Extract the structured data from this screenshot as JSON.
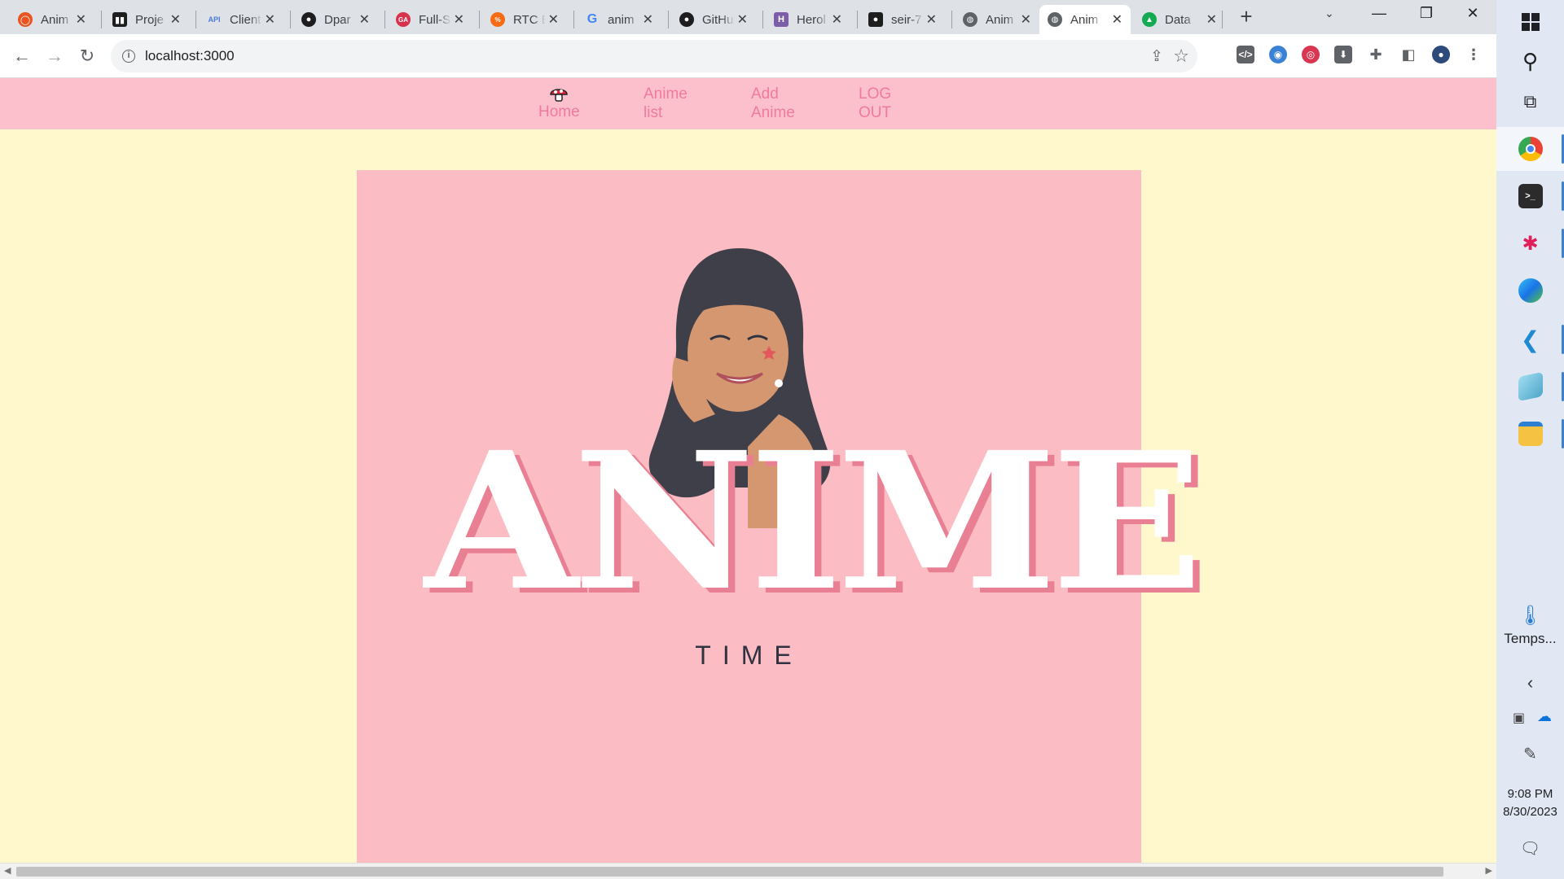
{
  "browser": {
    "tabs": [
      {
        "title": "Anim",
        "icon": "ubuntu-icon",
        "color": "#e95420"
      },
      {
        "title": "Proje",
        "icon": "trello-icon",
        "color": "#1e1e1e"
      },
      {
        "title": "Client",
        "icon": "api-icon",
        "color": "#4a7bd8"
      },
      {
        "title": "Dpar",
        "icon": "github-icon",
        "color": "#1e1e1e"
      },
      {
        "title": "Full-S",
        "icon": "ga-icon",
        "color": "#d9304b"
      },
      {
        "title": "RTC E",
        "icon": "rtc-icon",
        "color": "#f76b15"
      },
      {
        "title": "anim",
        "icon": "google-icon",
        "color": "#4285f4"
      },
      {
        "title": "GitHu",
        "icon": "github-icon",
        "color": "#1e1e1e"
      },
      {
        "title": "Herol",
        "icon": "heroku-icon",
        "color": "#7b5ea7"
      },
      {
        "title": "seir-7",
        "icon": "github-icon",
        "color": "#1e1e1e"
      },
      {
        "title": "Anim",
        "icon": "globe-icon",
        "color": "#5f6368"
      },
      {
        "title": "Anim",
        "icon": "globe-icon",
        "color": "#5f6368"
      },
      {
        "title": "Data",
        "icon": "mongodb-icon",
        "color": "#13aa52"
      }
    ],
    "active_tab": 11,
    "url": "localhost:3000"
  },
  "navbar": {
    "home_label": "Home",
    "anime_list_label_1": "Anime",
    "anime_list_label_2": "list",
    "add_anime_label_1": "Add",
    "add_anime_label_2": "Anime",
    "logout_label_1": "LOG",
    "logout_label_2": "OUT"
  },
  "hero": {
    "word": "ANIME",
    "subtitle": "TIME"
  },
  "taskbar": {
    "temps_label": "Temps...",
    "time": "9:08 PM",
    "date": "8/30/2023"
  },
  "colors": {
    "nav_background": "#fbc0cb",
    "nav_link": "#f07aa0",
    "page_background": "#fef8cc",
    "hero_background": "#fbbdc3"
  }
}
